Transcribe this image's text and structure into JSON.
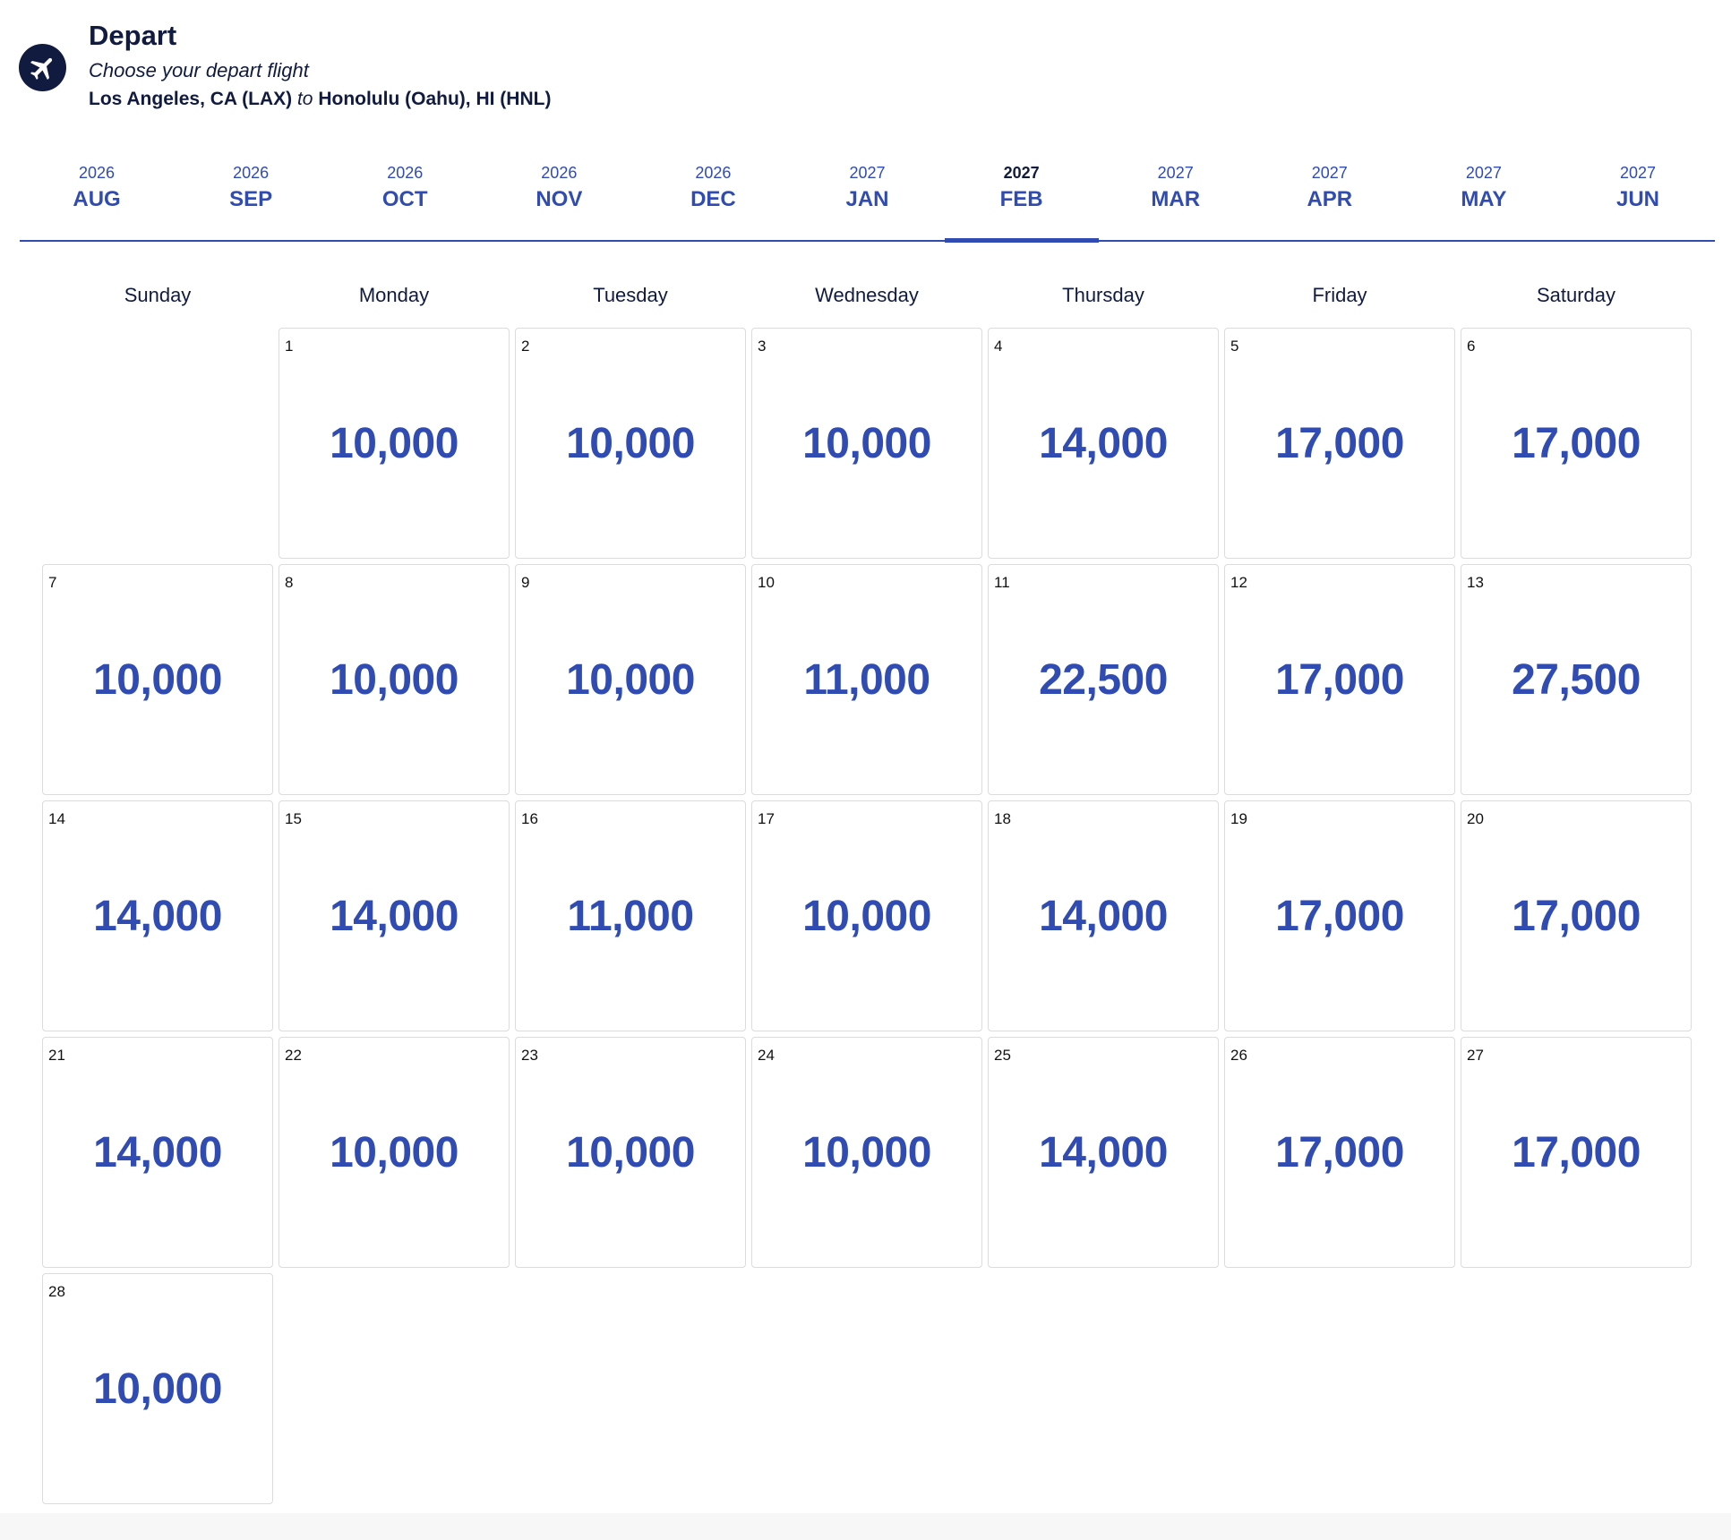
{
  "header": {
    "icon": "airplane-icon",
    "title": "Depart",
    "subtitle": "Choose your depart flight",
    "origin": "Los Angeles, CA (LAX)",
    "connector": "to",
    "destination": "Honolulu (Oahu), HI (HNL)"
  },
  "tabs": [
    {
      "year": "2026",
      "month": "AUG",
      "active": false
    },
    {
      "year": "2026",
      "month": "SEP",
      "active": false
    },
    {
      "year": "2026",
      "month": "OCT",
      "active": false
    },
    {
      "year": "2026",
      "month": "NOV",
      "active": false
    },
    {
      "year": "2026",
      "month": "DEC",
      "active": false
    },
    {
      "year": "2027",
      "month": "JAN",
      "active": false
    },
    {
      "year": "2027",
      "month": "FEB",
      "active": true
    },
    {
      "year": "2027",
      "month": "MAR",
      "active": false
    },
    {
      "year": "2027",
      "month": "APR",
      "active": false
    },
    {
      "year": "2027",
      "month": "MAY",
      "active": false
    },
    {
      "year": "2027",
      "month": "JUN",
      "active": false
    }
  ],
  "weekdays": [
    "Sunday",
    "Monday",
    "Tuesday",
    "Wednesday",
    "Thursday",
    "Friday",
    "Saturday"
  ],
  "calendar": {
    "first_weekday_index": 1,
    "days": [
      {
        "day": "1",
        "price": "10,000"
      },
      {
        "day": "2",
        "price": "10,000"
      },
      {
        "day": "3",
        "price": "10,000"
      },
      {
        "day": "4",
        "price": "14,000"
      },
      {
        "day": "5",
        "price": "17,000"
      },
      {
        "day": "6",
        "price": "17,000"
      },
      {
        "day": "7",
        "price": "10,000"
      },
      {
        "day": "8",
        "price": "10,000"
      },
      {
        "day": "9",
        "price": "10,000"
      },
      {
        "day": "10",
        "price": "11,000"
      },
      {
        "day": "11",
        "price": "22,500"
      },
      {
        "day": "12",
        "price": "17,000"
      },
      {
        "day": "13",
        "price": "27,500"
      },
      {
        "day": "14",
        "price": "14,000"
      },
      {
        "day": "15",
        "price": "14,000"
      },
      {
        "day": "16",
        "price": "11,000"
      },
      {
        "day": "17",
        "price": "10,000"
      },
      {
        "day": "18",
        "price": "14,000"
      },
      {
        "day": "19",
        "price": "17,000"
      },
      {
        "day": "20",
        "price": "17,000"
      },
      {
        "day": "21",
        "price": "14,000"
      },
      {
        "day": "22",
        "price": "10,000"
      },
      {
        "day": "23",
        "price": "10,000"
      },
      {
        "day": "24",
        "price": "10,000"
      },
      {
        "day": "25",
        "price": "14,000"
      },
      {
        "day": "26",
        "price": "17,000"
      },
      {
        "day": "27",
        "price": "17,000"
      },
      {
        "day": "28",
        "price": "10,000"
      }
    ]
  },
  "colors": {
    "accent": "#304cb2",
    "navy": "#111b40",
    "cell_border": "#dcdcdc"
  }
}
